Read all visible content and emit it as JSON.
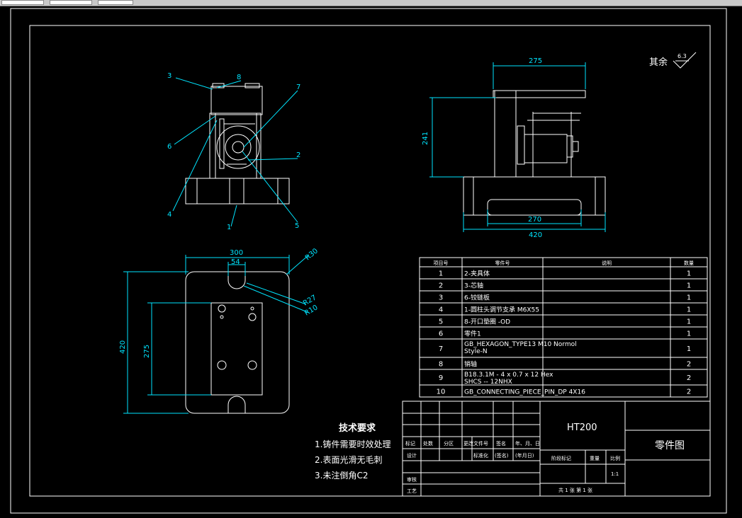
{
  "window": {
    "toolbar_fields": [
      "",
      "",
      ""
    ]
  },
  "drawing": {
    "surface_finish": {
      "label": "其余",
      "value": "6.3"
    },
    "front_view": {
      "callouts": [
        "3",
        "8",
        "7",
        "6",
        "2",
        "4",
        "1",
        "5"
      ]
    },
    "side_view": {
      "dims": {
        "top_width": "275",
        "height": "241",
        "inner_width": "270",
        "base_width": "420"
      }
    },
    "top_view": {
      "dims": {
        "width": "300",
        "slot": "54",
        "corner_radius": "R30",
        "r27": "R27",
        "r10": "R10",
        "height": "420",
        "inner_height": "275"
      }
    },
    "bom": {
      "headers": [
        "项目号",
        "零件号",
        "说明",
        "数量"
      ],
      "rows": [
        {
          "no": "1",
          "part": "2-夹具体",
          "desc": "",
          "qty": "1"
        },
        {
          "no": "2",
          "part": "3-芯轴",
          "desc": "",
          "qty": "1"
        },
        {
          "no": "3",
          "part": "6-铰链板",
          "desc": "",
          "qty": "1"
        },
        {
          "no": "4",
          "part": "1-圆柱头调节支承 M6X55",
          "desc": "",
          "qty": "1"
        },
        {
          "no": "5",
          "part": "8-开口垫圈 -OD",
          "desc": "",
          "qty": "1"
        },
        {
          "no": "6",
          "part": "零件1",
          "desc": "",
          "qty": "1"
        },
        {
          "no": "7",
          "part": "GB_HEXAGON_TYPE13 M10 Normol\nStyle-N",
          "desc": "",
          "qty": "1"
        },
        {
          "no": "8",
          "part": "销轴",
          "desc": "",
          "qty": "2"
        },
        {
          "no": "9",
          "part": "B18.3.1M - 4 x 0.7 x 12 Hex\nSHCS -- 12NHX",
          "desc": "",
          "qty": "2"
        },
        {
          "no": "10",
          "part": "GB_CONNECTING_PIECE_PIN_DP 4X16",
          "desc": "",
          "qty": "2"
        }
      ]
    },
    "tech_requirements": {
      "title": "技术要求",
      "items": [
        "1.铸件需要时效处理",
        "2.表面光滑无毛刺",
        "3.未注倒角C2"
      ]
    },
    "title_block": {
      "material": "HT200",
      "drawing_name": "零件图",
      "row_labels": [
        "标记",
        "处数",
        "分区",
        "更改文件号",
        "签名",
        "年、月、日"
      ],
      "design": "设计",
      "standardization": "标准化",
      "signature_paren": "(签名)",
      "date_paren": "(年月日)",
      "stage_mark": "阶段标记",
      "weight": "重量",
      "scale": "比例",
      "scale_value": "1:1",
      "review": "审核",
      "process": "工艺",
      "sheets": "共 1 张 第 1 张"
    }
  },
  "colors": {
    "line": "#ffffff",
    "dimension": "#00e5ff",
    "background": "#000000"
  }
}
